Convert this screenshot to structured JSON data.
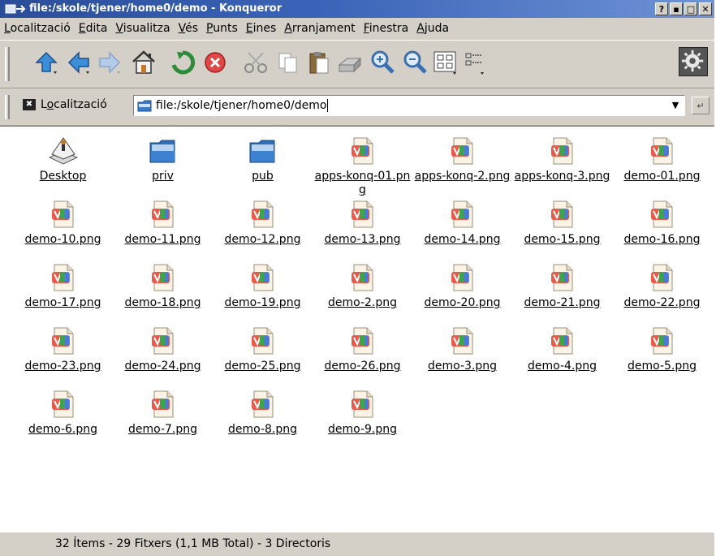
{
  "window": {
    "title": "file:/skole/tjener/home0/demo - Konqueror",
    "buttons": [
      "?",
      "▪",
      "□",
      "✕"
    ]
  },
  "menubar": {
    "items": [
      {
        "u": "L",
        "rest": "ocalització"
      },
      {
        "u": "E",
        "rest": "dita"
      },
      {
        "u": "V",
        "rest": "isualitza"
      },
      {
        "u": "V",
        "rest": "és"
      },
      {
        "u": "P",
        "rest": "unts"
      },
      {
        "u": "E",
        "rest": "ines"
      },
      {
        "u": "A",
        "rest": "rranjament"
      },
      {
        "u": "F",
        "rest": "inestra"
      },
      {
        "u": "A",
        "rest": "juda"
      }
    ]
  },
  "toolbar": {
    "icons": [
      "up-arrow-icon",
      "back-arrow-icon",
      "forward-arrow-icon",
      "home-icon",
      "reload-icon",
      "stop-icon",
      "cut-icon",
      "copy-icon",
      "paste-icon",
      "print-icon",
      "zoom-in-icon",
      "zoom-out-icon",
      "icon-view-icon",
      "detail-view-icon"
    ]
  },
  "location": {
    "label_pre": "L",
    "label_u": "o",
    "label_post": "calització",
    "value": "file:/skole/tjener/home0/demo"
  },
  "files": [
    {
      "name": "Desktop",
      "type": "desktop"
    },
    {
      "name": "priv",
      "type": "folder"
    },
    {
      "name": "pub",
      "type": "folder"
    },
    {
      "name": "apps-konq-01.png",
      "type": "image"
    },
    {
      "name": "apps-konq-2.png",
      "type": "image"
    },
    {
      "name": "apps-konq-3.png",
      "type": "image"
    },
    {
      "name": "demo-01.png",
      "type": "image"
    },
    {
      "name": "demo-10.png",
      "type": "image"
    },
    {
      "name": "demo-11.png",
      "type": "image"
    },
    {
      "name": "demo-12.png",
      "type": "image"
    },
    {
      "name": "demo-13.png",
      "type": "image"
    },
    {
      "name": "demo-14.png",
      "type": "image"
    },
    {
      "name": "demo-15.png",
      "type": "image"
    },
    {
      "name": "demo-16.png",
      "type": "image"
    },
    {
      "name": "demo-17.png",
      "type": "image"
    },
    {
      "name": "demo-18.png",
      "type": "image"
    },
    {
      "name": "demo-19.png",
      "type": "image"
    },
    {
      "name": "demo-2.png",
      "type": "image"
    },
    {
      "name": "demo-20.png",
      "type": "image"
    },
    {
      "name": "demo-21.png",
      "type": "image"
    },
    {
      "name": "demo-22.png",
      "type": "image"
    },
    {
      "name": "demo-23.png",
      "type": "image"
    },
    {
      "name": "demo-24.png",
      "type": "image"
    },
    {
      "name": "demo-25.png",
      "type": "image"
    },
    {
      "name": "demo-26.png",
      "type": "image"
    },
    {
      "name": "demo-3.png",
      "type": "image"
    },
    {
      "name": "demo-4.png",
      "type": "image"
    },
    {
      "name": "demo-5.png",
      "type": "image"
    },
    {
      "name": "demo-6.png",
      "type": "image"
    },
    {
      "name": "demo-7.png",
      "type": "image"
    },
    {
      "name": "demo-8.png",
      "type": "image"
    },
    {
      "name": "demo-9.png",
      "type": "image"
    }
  ],
  "status": {
    "text": "32 Ítems - 29 Fitxers (1,1 MB Total) - 3 Directoris"
  }
}
